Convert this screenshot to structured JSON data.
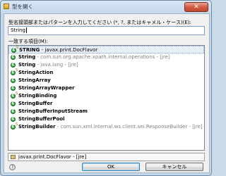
{
  "window": {
    "title": "型を開く",
    "close_glyph": "✕"
  },
  "prompt": "型名接頭部またはパターンを入力してください (*, ?, またはキャメル・ケース)(E):",
  "search": {
    "value": "String"
  },
  "list_label": "一致する項目(M):",
  "items": [
    {
      "name": "STRING",
      "rest": " - javax.print.DocFlavor",
      "modifier": "S",
      "selected": true,
      "rest_dark": true
    },
    {
      "name": "String",
      "rest": " - com.sun.org.apache.xpath.internal.operations - [jre]",
      "modifier": ""
    },
    {
      "name": "String",
      "rest": " - java.lang - [jre]",
      "modifier": ""
    },
    {
      "name": "StringAction",
      "rest": "",
      "modifier": "S"
    },
    {
      "name": "StringArray",
      "rest": "",
      "modifier": ""
    },
    {
      "name": "StringArrayWrapper",
      "rest": "",
      "modifier": ""
    },
    {
      "name": "StringBinding",
      "rest": "",
      "modifier": "S"
    },
    {
      "name": "StringBuffer",
      "rest": "",
      "modifier": ""
    },
    {
      "name": "StringBufferInputStream",
      "rest": "",
      "modifier": ""
    },
    {
      "name": "StringBufferPool",
      "rest": "",
      "modifier": ""
    },
    {
      "name": "StringBuilder",
      "rest": " - com.sun.xml.internal.ws.client.sei.ResponseBuilder - [jre]",
      "modifier": "S"
    }
  ],
  "detail": "javax.print.DocFlavor - [jre]",
  "buttons": {
    "ok": "OK",
    "cancel": "キャンセル"
  },
  "icons": {
    "title": "open-type-icon",
    "class": "class-icon",
    "package": "package-icon",
    "status": "help-icon"
  },
  "colors": {
    "class_icon": "#1d8a2b",
    "secondary_text": "#808080",
    "ok_border": "#3c7fb1"
  }
}
